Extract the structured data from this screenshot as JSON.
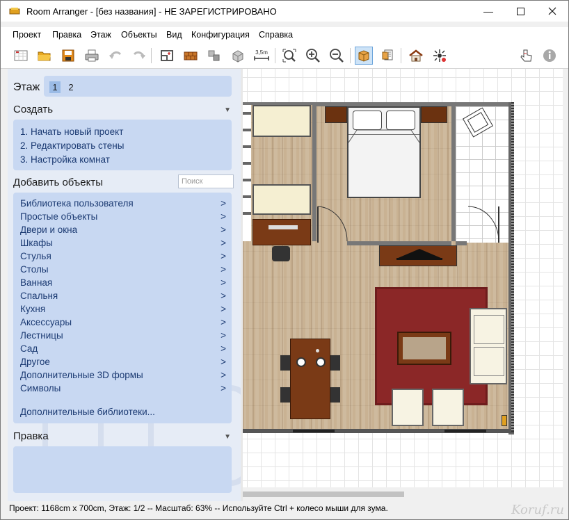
{
  "window": {
    "title": "Room Arranger - [без названия] - НЕ ЗАРЕГИСТРИРОВАНО",
    "app_icon": "room-arranger-icon",
    "controls": [
      "minimize-icon",
      "maximize-icon",
      "close-icon"
    ]
  },
  "menu": {
    "items": [
      "Проект",
      "Правка",
      "Этаж",
      "Объекты",
      "Вид",
      "Конфигурация",
      "Справка"
    ]
  },
  "toolbar": {
    "buttons": [
      "new-project-icon",
      "open-folder-icon",
      "save-icon",
      "print-icon",
      "undo-icon",
      "redo-icon",
      "add-room-icon",
      "add-wall-icon",
      "select-objects-icon",
      "3d-objects-icon",
      "measure-icon",
      "zoom-fit-icon",
      "zoom-in-icon",
      "zoom-out-icon",
      "view-2d-icon",
      "view-list-icon",
      "3d-house-icon",
      "lighting-icon",
      "hand-pointer-icon",
      "info-icon"
    ],
    "measure_label": "3,5m",
    "active": "view-2d-icon"
  },
  "left_panel": {
    "floor": {
      "label": "Этаж",
      "floors": [
        "1",
        "2"
      ],
      "selected": "1"
    },
    "create": {
      "title": "Создать",
      "steps": [
        "1. Начать новый проект",
        "2. Редактировать стены",
        "3. Настройка комнат"
      ]
    },
    "add_objects": {
      "title": "Добавить объекты",
      "search_placeholder": "Поиск",
      "items": [
        "Библиотека пользователя",
        "Простые объекты",
        "Двери и окна",
        "Шкафы",
        "Стулья",
        "Столы",
        "Ванная",
        "Спальня",
        "Кухня",
        "Аксессуары",
        "Лестницы",
        "Сад",
        "Другое",
        "Дополнительные 3D формы",
        "Символы"
      ],
      "chevron": ">",
      "more": "Дополнительные библиотеки..."
    },
    "edit": {
      "title": "Правка"
    }
  },
  "status": {
    "text": "Проект: 1168cm x 700cm, Этаж: 1/2 -- Масштаб: 63% -- Используйте Ctrl + колесо мыши для зума."
  },
  "watermark": "Koruf.ru",
  "colors": {
    "panel_bg": "#e6ecf6",
    "panel_box": "#c8d8f2",
    "link_text": "#1b3a72",
    "wall": "#777777",
    "rug": "#8b2727",
    "wood_dark": "#7a3a16"
  }
}
